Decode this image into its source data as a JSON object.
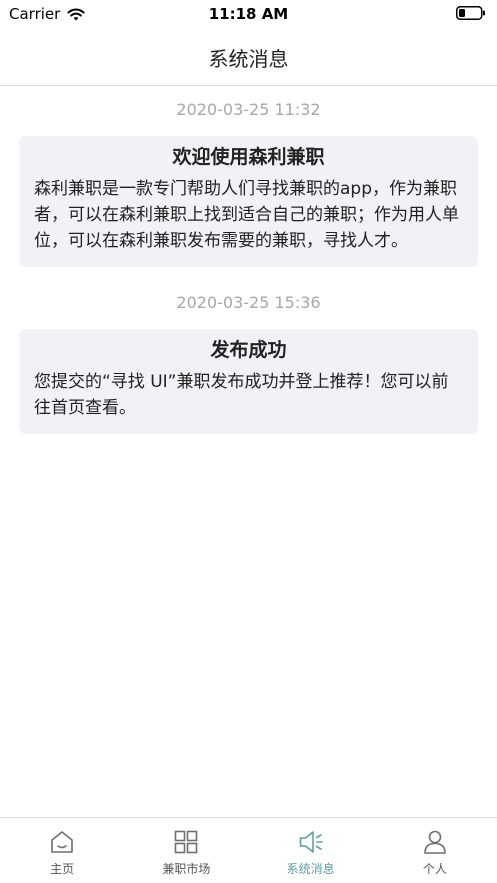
{
  "status_bar": {
    "carrier": "Carrier",
    "time": "11:18 AM"
  },
  "header": {
    "title": "系统消息"
  },
  "messages": [
    {
      "time": "2020-03-25 11:32",
      "title": "欢迎使用森利兼职",
      "body": "森利兼职是一款专门帮助人们寻找兼职的app，作为兼职者，可以在森利兼职上找到适合自己的兼职；作为用人单位，可以在森利兼职发布需要的兼职，寻找人才。"
    },
    {
      "time": "2020-03-25 15:36",
      "title": "发布成功",
      "body": "您提交的“寻找 UI”兼职发布成功并登上推荐！您可以前往首页查看。"
    }
  ],
  "tabs": [
    {
      "label": "主页",
      "icon": "home-icon"
    },
    {
      "label": "兼职市场",
      "icon": "grid-icon"
    },
    {
      "label": "系统消息",
      "icon": "megaphone-icon",
      "active": true
    },
    {
      "label": "个人",
      "icon": "person-icon"
    }
  ],
  "colors": {
    "active": "#5f9ea0",
    "inactive": "#555555",
    "card_bg": "#f1f1f6",
    "time_text": "#a7a7ac"
  }
}
